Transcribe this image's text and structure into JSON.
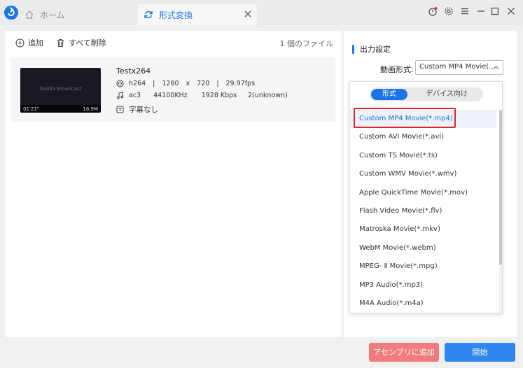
{
  "tabs": {
    "home": "ホーム",
    "convert": "形式変換"
  },
  "toolbar": {
    "add": "追加",
    "delete_all": "すべて削除",
    "file_count": "1 個のファイル"
  },
  "file": {
    "name": "Testx264",
    "thumb_title": "Nvidia Broadcast",
    "duration": "01'21\"",
    "size": "18.9M",
    "video": {
      "codec": "h264",
      "width": "1280",
      "x": "x",
      "height": "720",
      "fps": "29.97fps",
      "sep": "|"
    },
    "audio": {
      "codec": "ac3",
      "rate": "44100KHz",
      "bitrate": "1928 Kbps",
      "channels": "2(unknown)"
    },
    "subtitle": "字幕なし"
  },
  "output": {
    "title": "出力設定",
    "format_label": "動画形式:",
    "format_value": "Custom MP4 Movie(..."
  },
  "dropdown": {
    "tab_format": "形式",
    "tab_device": "デバイス向け",
    "options": [
      "Custom MP4 Movie(*.mp4)",
      "Custom AVI Movie(*.avi)",
      "Custom TS Movie(*.ts)",
      "Custom WMV Movie(*.wmv)",
      "Apple QuickTime Movie(*.mov)",
      "Flash Video Movie(*.flv)",
      "Matroska Movie(*.mkv)",
      "WebM Movie(*.webm)",
      "MPEG- Ⅱ Movie(*.mpg)",
      "MP3 Audio(*.mp3)",
      "M4A Audio(*.m4a)"
    ],
    "selected_index": 0
  },
  "buttons": {
    "queue": "アセンブリに追加",
    "start": "開始"
  },
  "colors": {
    "accent": "#1a73e8",
    "queue": "#f27b7b",
    "start": "#2f86ef",
    "highlight": "#d9262c"
  }
}
